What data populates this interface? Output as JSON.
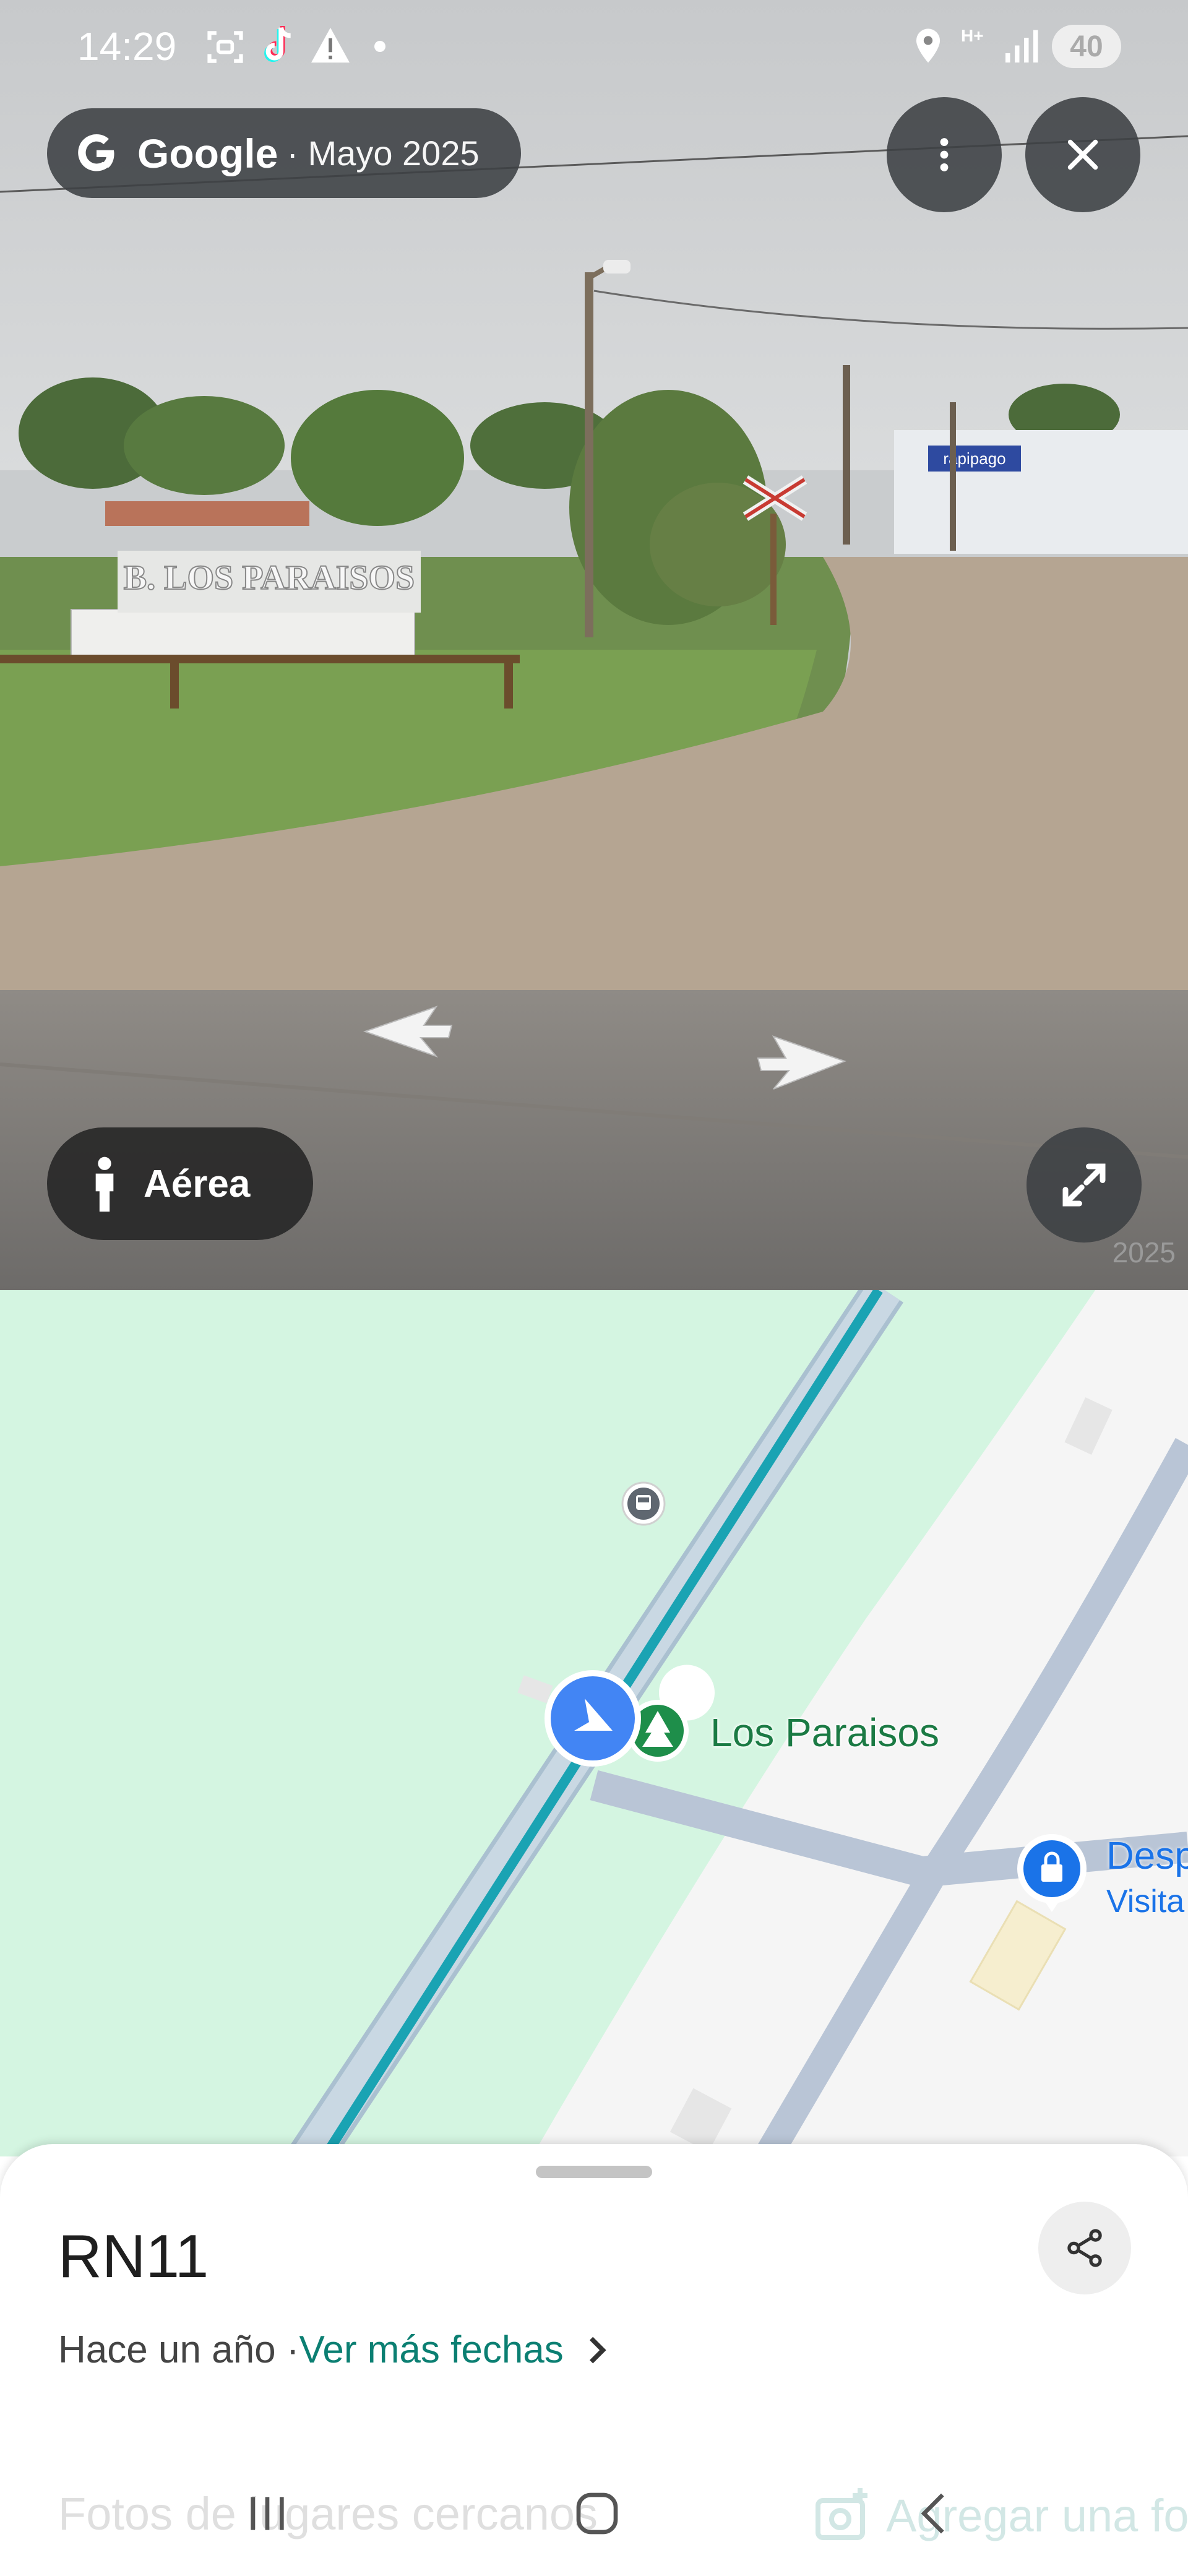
{
  "status_bar": {
    "time": "14:29",
    "battery": "40",
    "network": "H+"
  },
  "streetview": {
    "brand": "Google",
    "capture_date": "· Mayo 2025",
    "sign_text": "B. LOS PARAISOS",
    "store_sign": "rapipago",
    "watermark": "2025",
    "aerial_label": "Aérea"
  },
  "map": {
    "poi_name": "Los Paraisos",
    "poi2_name": "Desp",
    "poi2_subtitle": "Visita"
  },
  "sheet": {
    "title": "RN11",
    "date_prefix": "Hace un año · ",
    "date_link": "Ver más fechas",
    "nearby_photos": "Fotos de lugares cercanos",
    "add_photo": "Agregar una foto"
  },
  "colors": {
    "accent_link": "#0b7f72",
    "map_green": "#d4f5e1",
    "map_blue": "#1a73e8",
    "route_teal": "#1aa3b3"
  },
  "icons": [
    "google-g-icon",
    "more-vert-icon",
    "close-icon",
    "pegman-icon",
    "expand-icon",
    "bus-stop-icon",
    "navigation-arrow-icon",
    "park-icon",
    "shopping-bag-icon",
    "share-icon",
    "chevron-right-icon",
    "add-photo-icon",
    "recents-icon",
    "home-icon",
    "back-icon"
  ]
}
